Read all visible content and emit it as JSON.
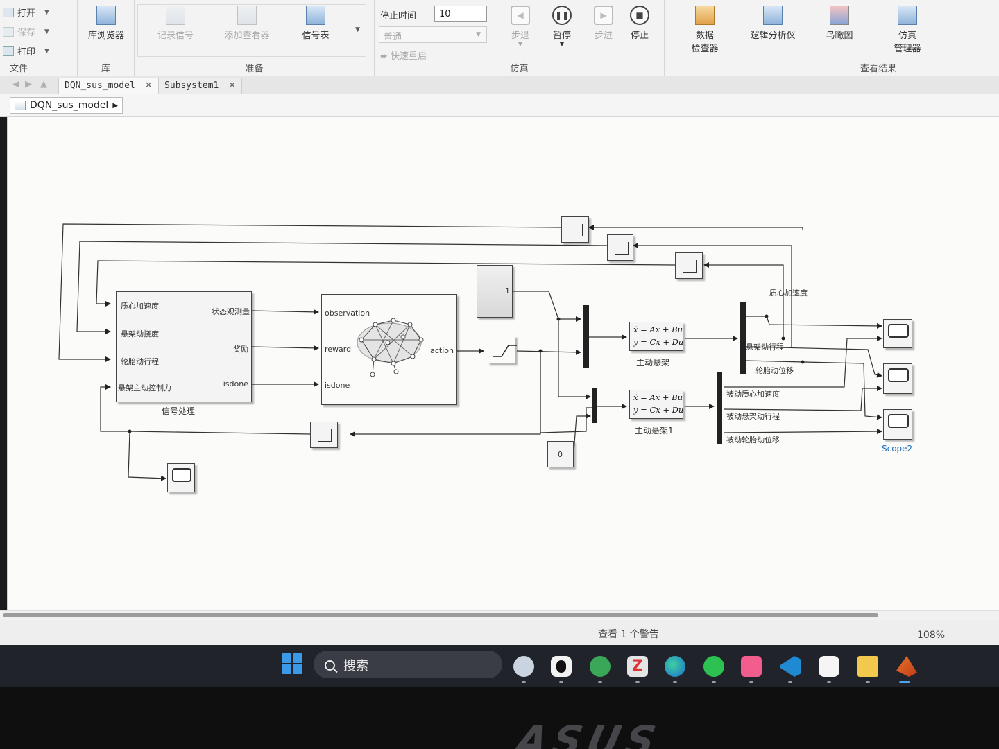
{
  "toolstrip": {
    "file": {
      "open": "打开",
      "save": "保存",
      "print": "打印",
      "section_label": "文件"
    },
    "library": {
      "browser": "库浏览器",
      "section_label": "库"
    },
    "prepare": {
      "record_signals": "记录信号",
      "add_viewer": "添加查看器",
      "signal_table": "信号表",
      "section_label": "准备"
    },
    "simulate": {
      "stop_time_label": "停止时间",
      "stop_time_value": "10",
      "mode_value": "普通",
      "fast_restart": "快速重启",
      "step_back": "步退",
      "pause": "暂停",
      "step_forward": "步进",
      "stop": "停止",
      "section_label": "仿真"
    },
    "review": {
      "data_inspector_line1": "数据",
      "data_inspector_line2": "检查器",
      "logic_analyzer": "逻辑分析仪",
      "birds_eye": "鸟瞰图",
      "sim_manager_line1": "仿真",
      "sim_manager_line2": "管理器",
      "section_label": "查看结果"
    }
  },
  "tabs": [
    {
      "label": "DQN_sus_model",
      "close": "✕"
    },
    {
      "label": "Subsystem1",
      "close": "✕"
    }
  ],
  "breadcrumb": {
    "model": "DQN_sus_model",
    "arrow": "▶"
  },
  "diagram": {
    "signal_proc": {
      "inputs": [
        "质心加速度",
        "悬架动挠度",
        "轮胎动行程",
        "悬架主动控制力"
      ],
      "outputs": [
        "状态观测量",
        "奖励",
        "isdone"
      ],
      "caption": "信号处理"
    },
    "agent": {
      "inputs": [
        "observation",
        "reward",
        "isdone"
      ],
      "output": "action"
    },
    "const_one": "1",
    "const_zero": "0",
    "ss_active": {
      "eq1": "ẋ = Ax + Bu",
      "eq2": "y = Cx + Du",
      "caption": "主动悬架"
    },
    "ss_passive": {
      "eq1": "ẋ = Ax + Bu",
      "eq2": "y = Cx + Du",
      "caption": "主动悬架1"
    },
    "active_signals": [
      "质心加速度",
      "悬架动行程",
      "轮胎动位移"
    ],
    "passive_signals": [
      "被动质心加速度",
      "被动悬架动行程",
      "被动轮胎动位移"
    ],
    "scope2_label": "Scope2"
  },
  "status": {
    "warning": "查看 1 个警告",
    "zoom": "108%"
  },
  "taskbar": {
    "search_placeholder": "搜索"
  },
  "bezel": {
    "brand": "ASUS"
  },
  "colors": {
    "taskbar": "#20232a",
    "link": "#1f6fbf",
    "accent": "#3b9ae8"
  }
}
